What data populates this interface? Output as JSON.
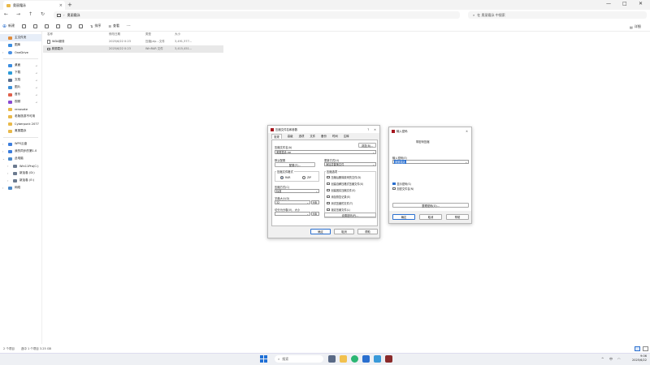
{
  "window": {
    "tab_title": "奥丽霜泳",
    "new_tab": "+",
    "address_crumb": "奥丽霜泳",
    "search_placeholder": "在 奥丽霜泳 中搜索"
  },
  "toolbar": {
    "new_label": "新建",
    "sort_label": "排序",
    "view_label": "查看",
    "more": "···",
    "details_label": "详细"
  },
  "sidebar": {
    "home": "主文件夹",
    "gallery": "图库",
    "onedrive": "OneDrive",
    "quick": [
      {
        "label": "桌面"
      },
      {
        "label": "下载"
      },
      {
        "label": "文档"
      },
      {
        "label": "图片"
      },
      {
        "label": "音乐"
      },
      {
        "label": "视频"
      },
      {
        "label": "renovate"
      },
      {
        "label": "老版旅游不可用"
      },
      {
        "label": "Cyberpunk 2077"
      },
      {
        "label": "奥丽霜泳"
      }
    ],
    "wps": "WPS云盘",
    "wps_sync": "我的同步的第1.0",
    "this_pc": "此电脑",
    "drives": [
      {
        "label": "Win11Pro(C:)"
      },
      {
        "label": "新加卷 (D:)"
      },
      {
        "label": "新加卷 (E:)"
      }
    ],
    "network": "网络"
  },
  "filelist": {
    "headers": {
      "name": "名称",
      "modified": "修改日期",
      "type": "类型",
      "size": "大小"
    },
    "rows": [
      {
        "name": "WDA服务",
        "modified": "2025/6/22 0:23",
        "type": "压缩(zip…文件",
        "size": "3,491,377…"
      },
      {
        "name": "奥丽霜泳",
        "modified": "2025/6/22 0:23",
        "type": "WinRAR 文件",
        "size": "3,415,451…"
      }
    ]
  },
  "status": {
    "count": "2 个项目",
    "selected": "选中 1 个项目  3.25 GB"
  },
  "taskbar": {
    "search": "搜索",
    "lang": "中",
    "time": "9:06",
    "date": "2025/6/22"
  },
  "archive_dialog": {
    "title": "压缩文件名和参数",
    "tabs": [
      "常规",
      "高级",
      "选项",
      "文件",
      "备份",
      "时间",
      "注释"
    ],
    "archive_name_label": "压缩文件名(A)",
    "browse": "浏览(B)...",
    "archive_name_value": "奥丽霜泳.rar",
    "profiles_label": "默认配置",
    "profiles_button": "配置(F)...",
    "update_mode_label": "更新方式(U)",
    "update_mode_value": "添加并替换文件",
    "format_label": "压缩文件格式",
    "format_rar": "RAR",
    "format_zip": "ZIP",
    "method_label": "压缩方式(C)",
    "method_value": "标准",
    "dict_label": "字典大小(D)",
    "dict_value": "32",
    "dict_unit": "MB",
    "split_label": "切分为分卷(V)，大小",
    "split_unit": "MB",
    "options_label": "压缩选项",
    "options": [
      "压缩后删除原来的文件(D)",
      "创建自解压格式压缩文件(X)",
      "创建固实压缩文件(S)",
      "添加恢复记录(E)",
      "测试压缩的文件(T)",
      "锁定压缩文件(L)"
    ],
    "set_password": "设置密码(P)...",
    "ok": "确定",
    "cancel": "取消",
    "help": "帮助"
  },
  "password_dialog": {
    "title": "输入密码",
    "header": "带密码压缩",
    "enter_label": "输入密码(E)",
    "password_value": "奥丽霜泳",
    "show_password": "显示密码(S)",
    "encrypt_names": "加密文件名(N)",
    "organize": "整理密码(O)...",
    "ok": "确定",
    "cancel": "取消",
    "help": "帮助"
  }
}
